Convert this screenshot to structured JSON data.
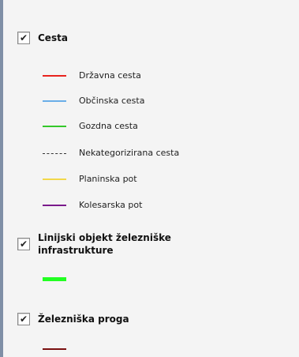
{
  "layers": [
    {
      "title": "Cesta",
      "checked": true,
      "legend": [
        {
          "label": "Državna cesta",
          "color": "#e8231e",
          "style": "solid"
        },
        {
          "label": "Občinska cesta",
          "color": "#6aaee8",
          "style": "solid"
        },
        {
          "label": "Gozdna cesta",
          "color": "#34c82a",
          "style": "solid"
        },
        {
          "label": "Nekategorizirana cesta",
          "color": "#333333",
          "style": "dashed"
        },
        {
          "label": "Planinska pot",
          "color": "#f2d84a",
          "style": "solid"
        },
        {
          "label": "Kolesarska pot",
          "color": "#7a1a8c",
          "style": "solid"
        }
      ]
    },
    {
      "title": "Linijski objekt železniške infrastrukture",
      "checked": true,
      "legend": [
        {
          "label": "",
          "color": "#22ff22",
          "style": "thick"
        }
      ]
    },
    {
      "title": "Železniška proga",
      "checked": true,
      "legend": [
        {
          "label": "",
          "color": "#7a1010",
          "style": "solid"
        }
      ]
    }
  ],
  "icons": {
    "checkbox_checked": "check-icon"
  }
}
